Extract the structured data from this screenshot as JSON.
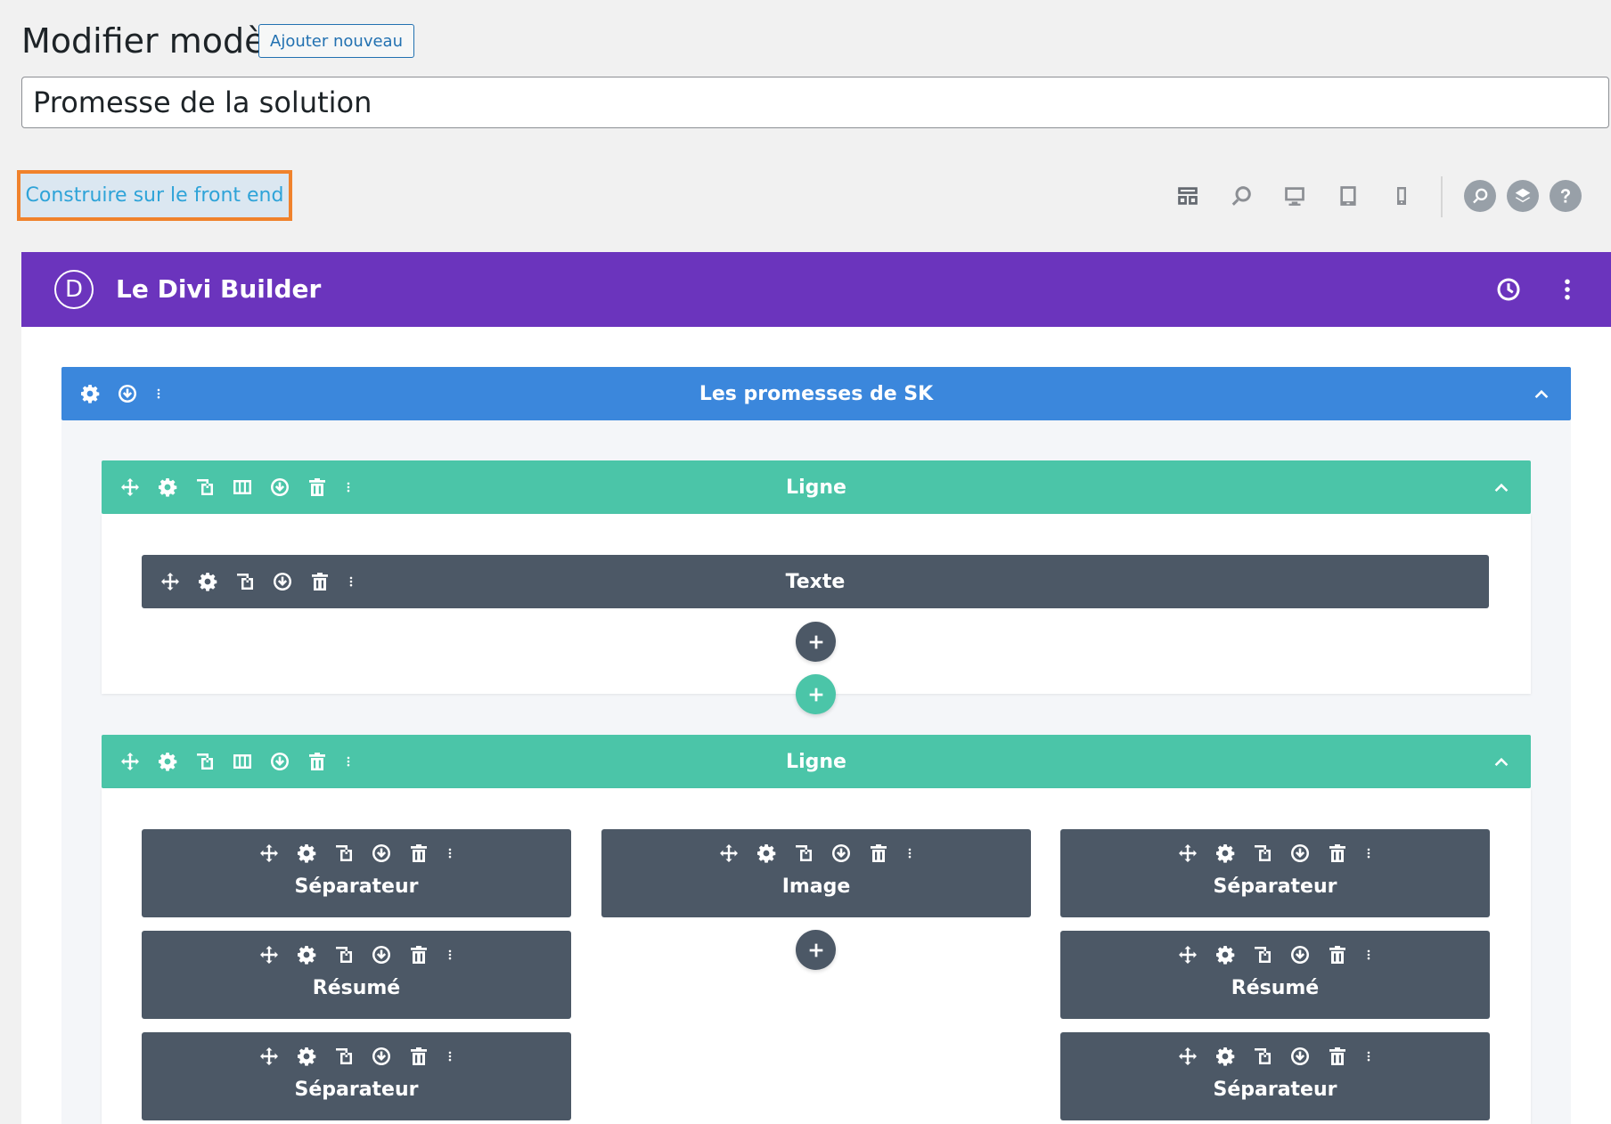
{
  "header": {
    "page_title": "Modifier modèle",
    "add_new_label": "Ajouter nouveau",
    "title_value": "Promesse de la solution",
    "front_end_button": "Construire sur le front end"
  },
  "toolbar": {
    "icons": [
      "layout-icon",
      "zoom-icon",
      "desktop-icon",
      "tablet-icon",
      "phone-icon",
      "search-icon",
      "layers-icon",
      "help-icon"
    ]
  },
  "builder": {
    "title": "Le Divi Builder",
    "logo_letter": "D",
    "accent_color": "#6b34bd"
  },
  "section": {
    "title": "Les promesses de SK",
    "color": "#3b87dc"
  },
  "rows": [
    {
      "title": "Ligne",
      "modules": [
        {
          "title": "Texte"
        }
      ]
    },
    {
      "title": "Ligne",
      "columns": [
        {
          "modules": [
            {
              "title": "Séparateur"
            },
            {
              "title": "Résumé"
            },
            {
              "title": "Séparateur"
            }
          ]
        },
        {
          "modules": [
            {
              "title": "Image"
            }
          ]
        },
        {
          "modules": [
            {
              "title": "Séparateur"
            },
            {
              "title": "Résumé"
            },
            {
              "title": "Séparateur"
            }
          ]
        }
      ]
    }
  ],
  "colors": {
    "row": "#4bc5a8",
    "module": "#4c5866",
    "highlight": "#f0822c"
  }
}
